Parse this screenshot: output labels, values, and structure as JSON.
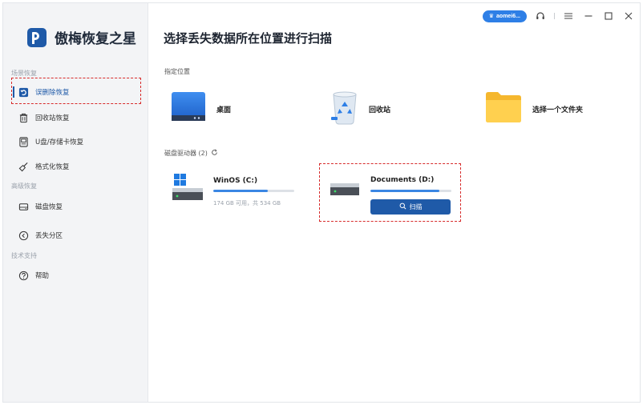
{
  "app": {
    "name": "傲梅恢复之星"
  },
  "titlebar": {
    "user": "aomei6..."
  },
  "sidebar": {
    "sections": [
      {
        "label": "场景恢复"
      },
      {
        "label": "高级恢复"
      },
      {
        "label": "技术支持"
      }
    ],
    "items": [
      {
        "label": "误删除恢复",
        "icon": "undo-icon"
      },
      {
        "label": "回收站恢复",
        "icon": "trash-icon"
      },
      {
        "label": "U盘/存储卡恢复",
        "icon": "sdcard-icon"
      },
      {
        "label": "格式化恢复",
        "icon": "broom-icon"
      },
      {
        "label": "磁盘恢复",
        "icon": "disk-icon"
      },
      {
        "label": "丢失分区",
        "icon": "partition-icon"
      },
      {
        "label": "帮助",
        "icon": "help-icon"
      }
    ]
  },
  "main": {
    "title": "选择丢失数据所在位置进行扫描",
    "locations_label": "指定位置",
    "locations": [
      {
        "label": "桌面"
      },
      {
        "label": "回收站"
      },
      {
        "label": "选择一个文件夹"
      }
    ],
    "drives_label": "磁盘驱动器 (2)",
    "drives": [
      {
        "name": "WinOS (C:)",
        "size_text": "174 GB 可用，共 534 GB",
        "used_fraction": 0.67
      },
      {
        "name": "Documents (D:)",
        "used_fraction": 0.85
      }
    ],
    "scan_label": "扫描"
  },
  "colors": {
    "accent": "#1f5aa8",
    "pill": "#2e7fe6",
    "highlight": "#d72a2a"
  }
}
